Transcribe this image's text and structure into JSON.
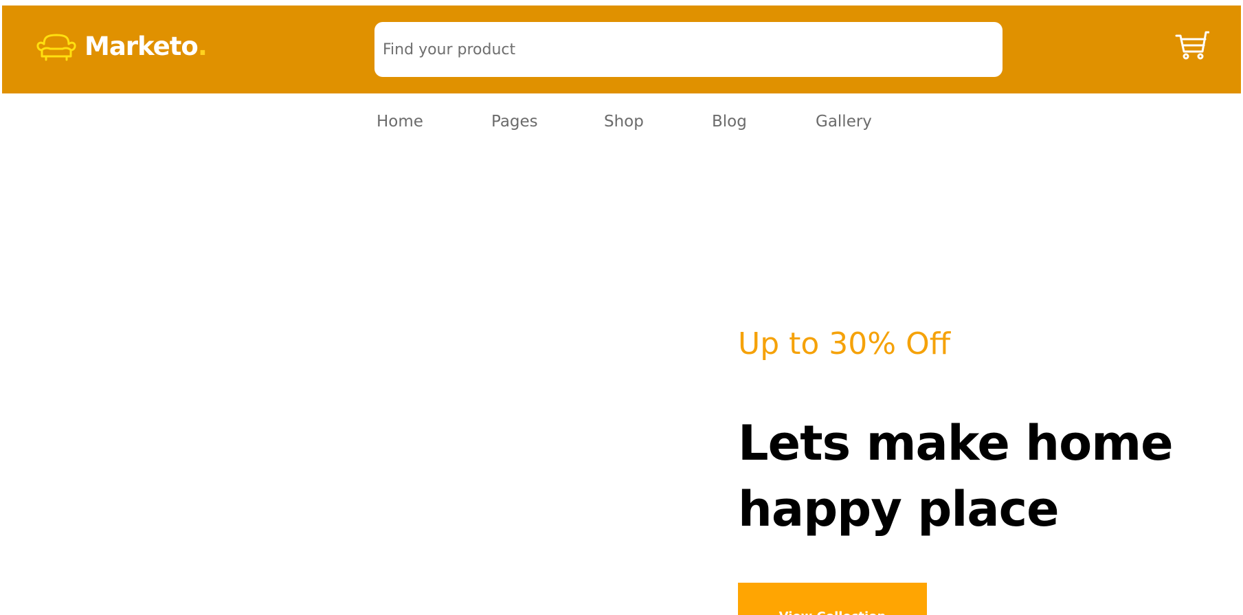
{
  "brand": {
    "name": "Marketo",
    "dot": ".",
    "logo_icon": "sofa-icon",
    "accent_color": "#e09100",
    "logo_icon_color": "#ffd21f"
  },
  "search": {
    "placeholder": "Find your product",
    "value": ""
  },
  "cart": {
    "icon": "cart-icon"
  },
  "nav": {
    "items": [
      {
        "label": "Home"
      },
      {
        "label": "Pages"
      },
      {
        "label": "Shop"
      },
      {
        "label": "Blog"
      },
      {
        "label": "Gallery"
      }
    ]
  },
  "hero": {
    "offer": "Up to 30% Off",
    "title_line1": "Lets make home",
    "title_line2": "happy place",
    "cta_label": "View Collection",
    "offer_color": "#f5a20a",
    "cta_color": "#ffa502"
  }
}
